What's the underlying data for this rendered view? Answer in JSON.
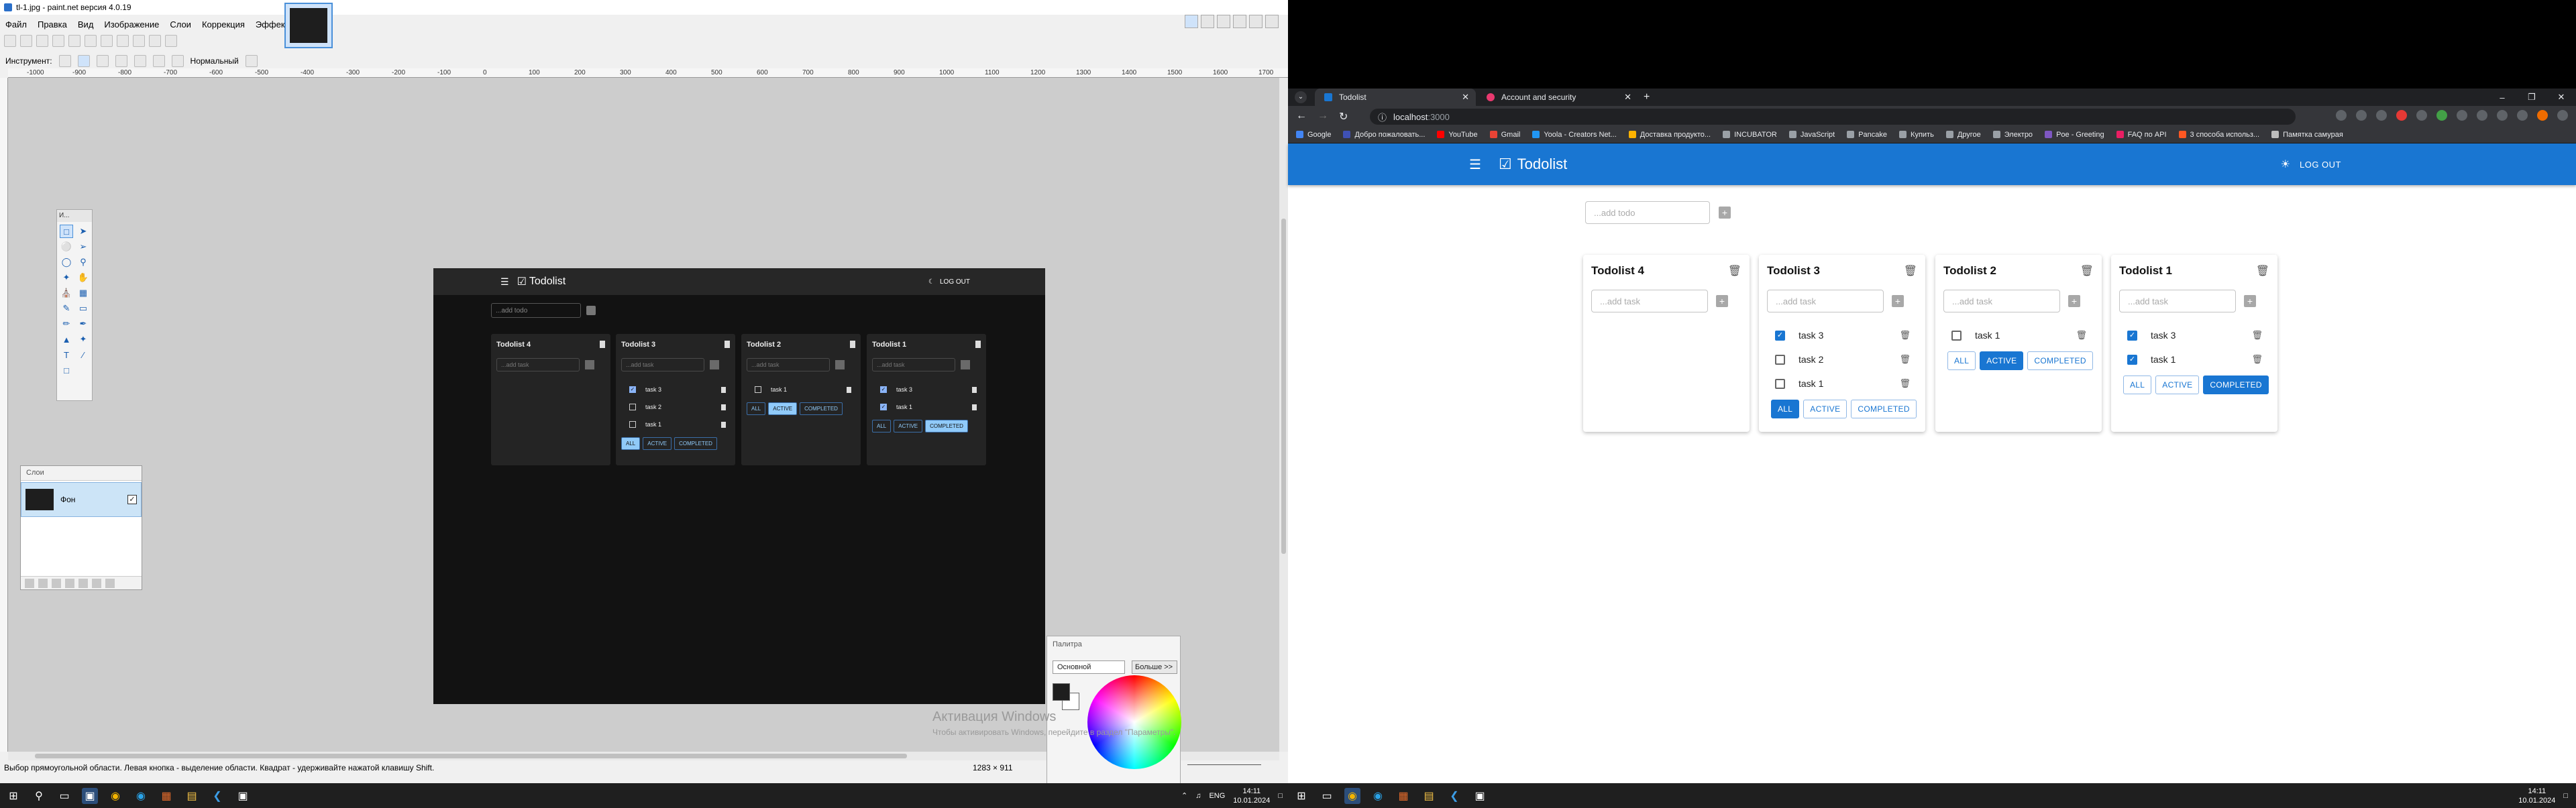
{
  "pdn": {
    "title": "tl-1.jpg - paint.net версия 4.0.19",
    "menu": [
      "Файл",
      "Правка",
      "Вид",
      "Изображение",
      "Слои",
      "Коррекция",
      "Эффекты"
    ],
    "tool_label": "Инструмент:",
    "blend_mode": "Нормальный",
    "tools_title": "И...",
    "layers_title": "Слои",
    "layer_name": "Фон",
    "palette_title": "Палитра",
    "palette_select": "Основной",
    "palette_more": "Больше >>",
    "status": "Выбор прямоугольной области. Левая кнопка - выделение области. Квадрат - удерживайте нажатой клавишу Shift.",
    "coords": "1283 × 911",
    "ruler_labels": [
      "-1000",
      "-900",
      "-800",
      "-700",
      "-600",
      "-500",
      "-400",
      "-300",
      "-200",
      "-100",
      "0",
      "100",
      "200",
      "300",
      "400",
      "500",
      "600",
      "700",
      "800",
      "900",
      "1000",
      "1100",
      "1200",
      "1300",
      "1400",
      "1500",
      "1600",
      "1700"
    ],
    "watermark_title": "Активация Windows",
    "watermark_sub": "Чтобы активировать Windows, перейдите в раздел \"Параметры\".",
    "image": {
      "brand": "Todolist",
      "logout": "LOG OUT",
      "add_placeholder": "...add todo",
      "task_placeholder": "...add task",
      "lists": [
        {
          "title": "Todolist 4",
          "tasks": [],
          "filters": []
        },
        {
          "title": "Todolist 3",
          "tasks": [
            {
              "label": "task 3",
              "done": true
            },
            {
              "label": "task 2",
              "done": false
            },
            {
              "label": "task 1",
              "done": false
            }
          ],
          "filters": [
            "ALL",
            "ACTIVE",
            "COMPLETED"
          ],
          "active": "ALL"
        },
        {
          "title": "Todolist 2",
          "tasks": [
            {
              "label": "task 1",
              "done": false
            }
          ],
          "filters": [
            "ALL",
            "ACTIVE",
            "COMPLETED"
          ],
          "active": "ACTIVE"
        },
        {
          "title": "Todolist 1",
          "tasks": [
            {
              "label": "task 3",
              "done": true
            },
            {
              "label": "task 1",
              "done": true
            }
          ],
          "filters": [
            "ALL",
            "ACTIVE",
            "COMPLETED"
          ],
          "active": "COMPLETED"
        }
      ]
    }
  },
  "taskbar_left": {
    "lang": "ENG",
    "time": "14:11",
    "date": "10.01.2024"
  },
  "taskbar_right": {
    "time": "14:11",
    "date": "10.01.2024"
  },
  "chrome": {
    "tabs": [
      {
        "title": "Todolist",
        "active": true,
        "favicon_color": "#1976d2"
      },
      {
        "title": "Account and security",
        "active": false,
        "favicon_color": "#e8396f"
      }
    ],
    "new_tab": "+",
    "url": "localhost",
    "url_port": ":3000",
    "bookmarks": [
      {
        "label": "Google",
        "color": "#4285f4"
      },
      {
        "label": "Добро пожаловать...",
        "color": "#3f51b5"
      },
      {
        "label": "YouTube",
        "color": "#ff0000"
      },
      {
        "label": "Gmail",
        "color": "#ea4335"
      },
      {
        "label": "Yoola - Creators Net...",
        "color": "#2196f3"
      },
      {
        "label": "Доставка продукто...",
        "color": "#ffb300"
      },
      {
        "label": "INCUBATOR",
        "color": "#9aa0a6"
      },
      {
        "label": "JavaScript",
        "color": "#9aa0a6"
      },
      {
        "label": "Pancake",
        "color": "#9aa0a6"
      },
      {
        "label": "Купить",
        "color": "#9aa0a6"
      },
      {
        "label": "Другое",
        "color": "#9aa0a6"
      },
      {
        "label": "Электро",
        "color": "#9aa0a6"
      },
      {
        "label": "Poe - Greeting",
        "color": "#7e57c2"
      },
      {
        "label": "FAQ по API",
        "color": "#e91e63"
      },
      {
        "label": "3 способа использ...",
        "color": "#ff5722"
      },
      {
        "label": "Памятка самурая",
        "color": "#bdbdbd"
      }
    ]
  },
  "app": {
    "brand": "Todolist",
    "logout": "LOG OUT",
    "add_placeholder": "...add todo",
    "task_placeholder": "...add task",
    "accent": "#1976d2",
    "lists": [
      {
        "title": "Todolist 4",
        "tasks": [],
        "filters": []
      },
      {
        "title": "Todolist 3",
        "tasks": [
          {
            "label": "task 3",
            "done": true
          },
          {
            "label": "task 2",
            "done": false
          },
          {
            "label": "task 1",
            "done": false
          }
        ],
        "filters": [
          "ALL",
          "ACTIVE",
          "COMPLETED"
        ],
        "active": "ALL"
      },
      {
        "title": "Todolist 2",
        "tasks": [
          {
            "label": "task 1",
            "done": false
          }
        ],
        "filters": [
          "ALL",
          "ACTIVE",
          "COMPLETED"
        ],
        "active": "ACTIVE"
      },
      {
        "title": "Todolist 1",
        "tasks": [
          {
            "label": "task 3",
            "done": true
          },
          {
            "label": "task 1",
            "done": true
          }
        ],
        "filters": [
          "ALL",
          "ACTIVE",
          "COMPLETED"
        ],
        "active": "COMPLETED"
      }
    ]
  }
}
